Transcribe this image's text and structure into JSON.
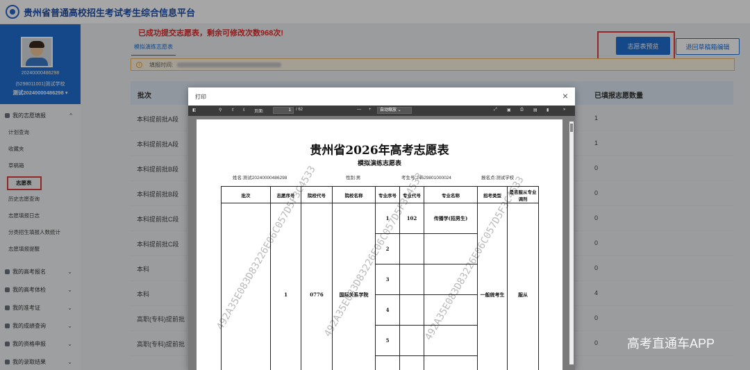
{
  "header": {
    "title": "贵州省普通高校招生考试考生综合信息平台"
  },
  "user": {
    "id": "20240000486298",
    "school": "(5298011001)测试学校",
    "name": "测试20240000486298"
  },
  "sidebar": {
    "group_volunteer": "我的志愿填报",
    "items": [
      "计划查询",
      "收藏夹",
      "草稿箱",
      "志愿表",
      "历史志愿查询",
      "志愿填报日志",
      "分类招生填报人数统计",
      "志愿填报提醒"
    ],
    "groups": [
      "我的高考报名",
      "我的高考体检",
      "我的准考证",
      "我的成绩查询",
      "我的资格申报",
      "我的录取结果"
    ]
  },
  "main": {
    "notice": "已成功提交志愿表，剩余可修改次数968次!",
    "tab": "模拟演练志愿表",
    "preview_button": "志愿表预览",
    "return_button": "退回草稿箱编辑",
    "fill_time_label": "填报时间:",
    "table_headers": {
      "batch": "批次",
      "count": "已填报志愿数量"
    },
    "rows": [
      {
        "batch": "本科提前批A段",
        "count": "1"
      },
      {
        "batch": "本科提前批A段",
        "count": "1"
      },
      {
        "batch": "本科提前批B段",
        "count": "0"
      },
      {
        "batch": "本科提前批B段",
        "count": "0"
      },
      {
        "batch": "本科提前批C段",
        "count": "0"
      },
      {
        "batch": "本科提前批C段",
        "count": "0"
      },
      {
        "batch": "本科",
        "count": "0"
      },
      {
        "batch": "本科",
        "count": "4"
      },
      {
        "batch": "高职(专科)提前批",
        "count": "0"
      },
      {
        "batch": "高职(专科)提前批",
        "count": "0"
      }
    ]
  },
  "modal": {
    "title": "打印",
    "close": "×",
    "toolbar": {
      "page_label": "页面:",
      "page_current": "1",
      "page_total": "/ 62",
      "zoom": "自动缩放"
    }
  },
  "pdf": {
    "title": "贵州省2026年高考志愿表",
    "subtitle": "模拟演练志愿表",
    "name": "姓名:测试20240000486298",
    "gender": "性别:男",
    "exam_no": "考生号:24529801000024",
    "site": "报名点:测试学校",
    "headers": [
      "批次",
      "志愿序号",
      "院校代号",
      "院校名称",
      "专业序号",
      "专业代号",
      "专业名称",
      "招考类型",
      "是否服从专业调剂"
    ],
    "row": {
      "seq": "1",
      "college_code": "0776",
      "college_name": "国际关系学院",
      "major_seqs": [
        "1",
        "2",
        "3",
        "4",
        "5"
      ],
      "major_code": "102",
      "major_name": "传播学(招男生)",
      "type": "一般统考生",
      "obey": "服从"
    },
    "watermark": "492A35E083D83226E06C057D5F3C4533"
  },
  "overlay_brand": "高考直通车APP"
}
